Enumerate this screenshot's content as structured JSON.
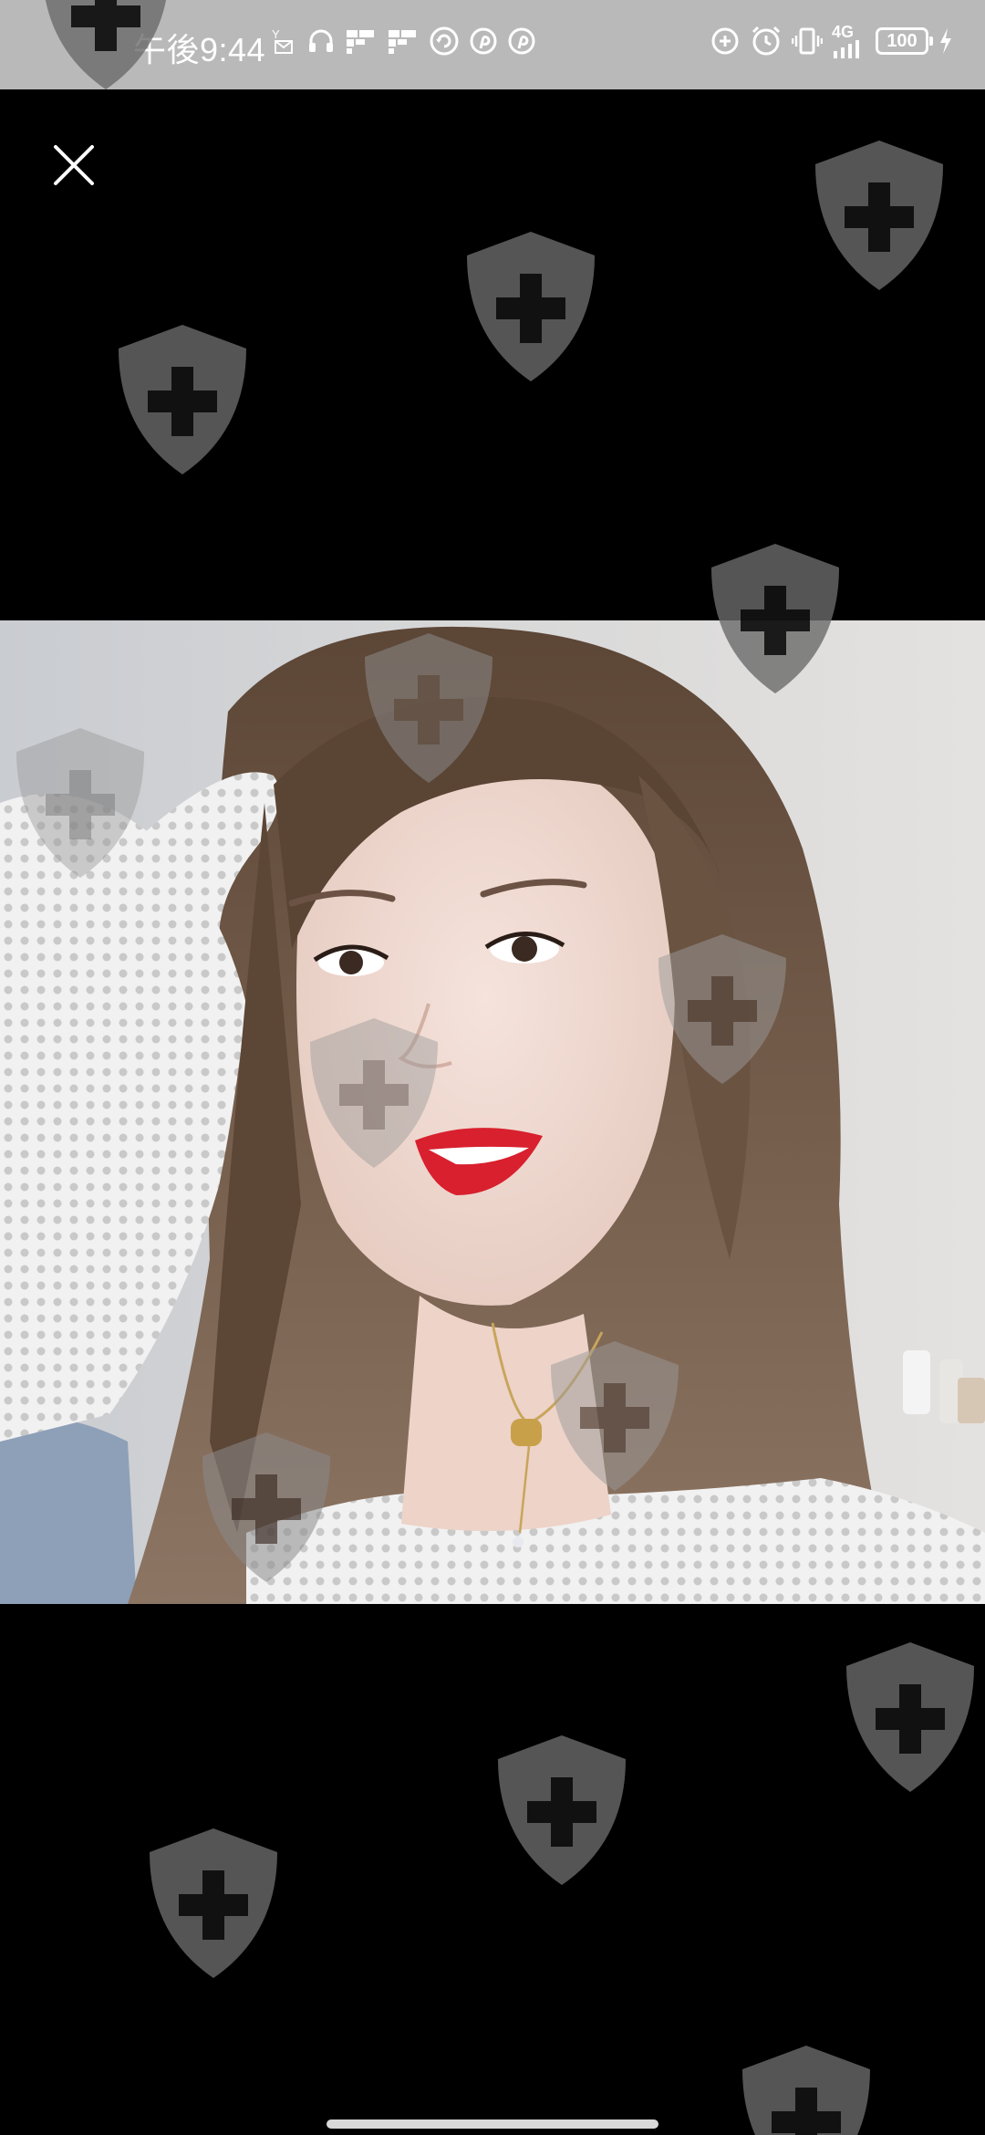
{
  "status_bar": {
    "time": "午後9:44",
    "network": "4G",
    "battery": "100"
  },
  "viewer": {
    "close_icon": "close-icon",
    "watermark_icon": "shield-plus-icon",
    "colors": {
      "background": "#000000",
      "status_bar": "#b9b9b9",
      "watermark": "#5a5a5a"
    }
  }
}
